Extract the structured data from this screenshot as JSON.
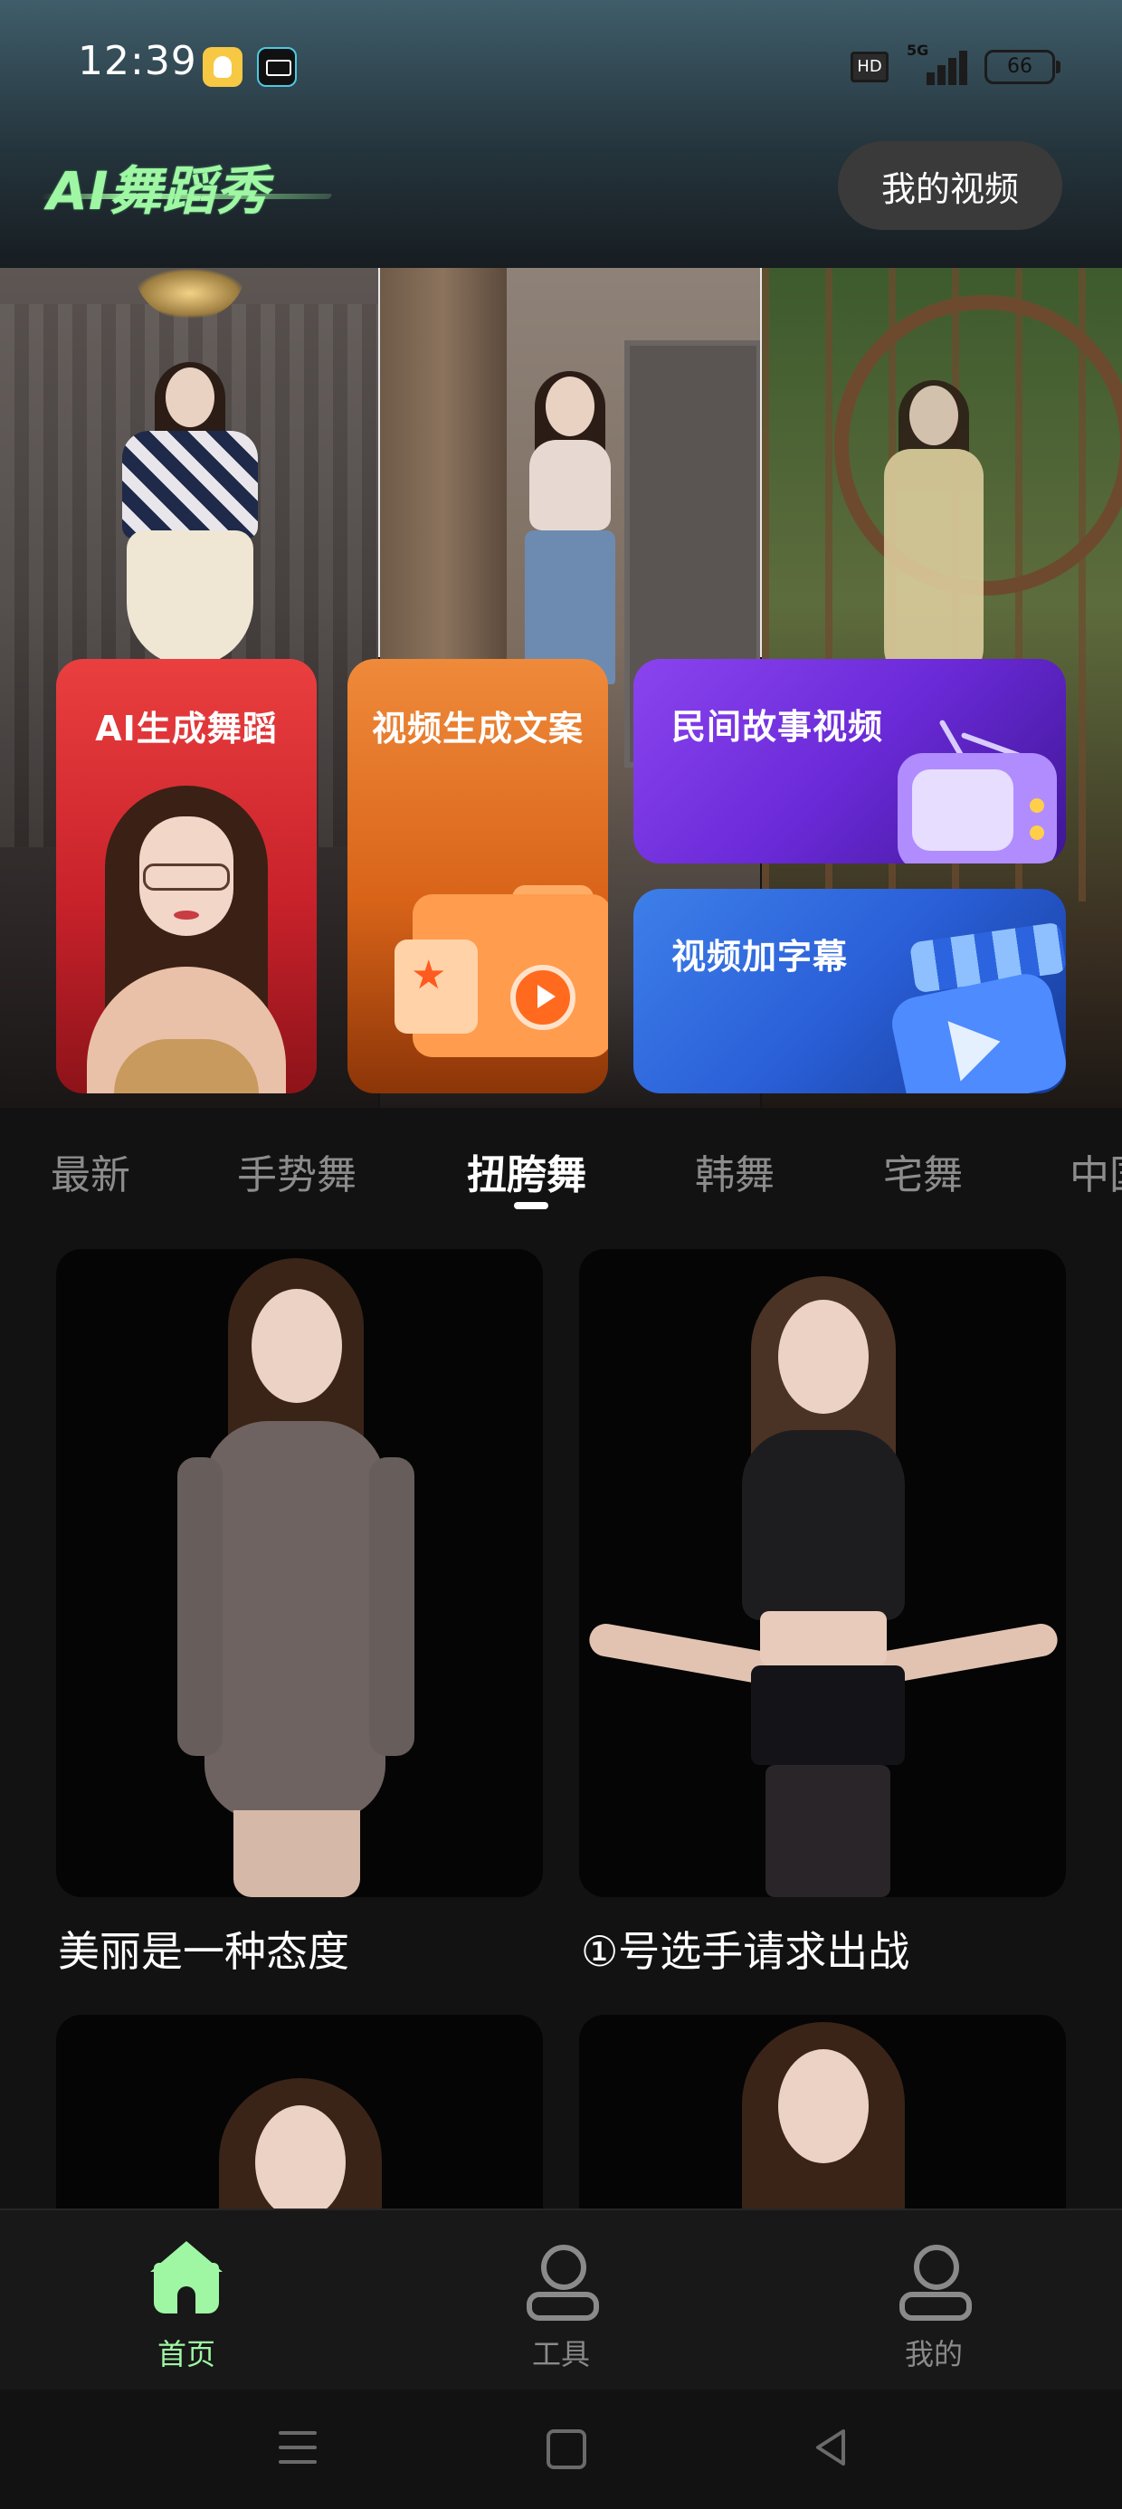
{
  "status_bar": {
    "time": "12:39",
    "network": "5G",
    "hd": "HD",
    "battery": "66"
  },
  "header": {
    "logo": "AI舞蹈秀",
    "my_videos_button": "我的视频"
  },
  "feature_cards": {
    "ai_dance": "AI生成舞蹈",
    "video_copy": "视频生成文案",
    "folk_story": "民间故事视频",
    "subtitle": "视频加字幕"
  },
  "tabs": [
    "最新",
    "手势舞",
    "扭胯舞",
    "韩舞",
    "宅舞",
    "中国"
  ],
  "active_tab": "扭胯舞",
  "videos": [
    {
      "title": "美丽是一种态度"
    },
    {
      "title": "①号选手请求出战"
    },
    {
      "title": ""
    },
    {
      "title": ""
    }
  ],
  "bottom_nav": {
    "home": "首页",
    "tools": "工具",
    "mine": "我的"
  },
  "colors": {
    "accent": "#9ff7a3",
    "background": "#121212",
    "inactive": "#8a8a8a"
  }
}
